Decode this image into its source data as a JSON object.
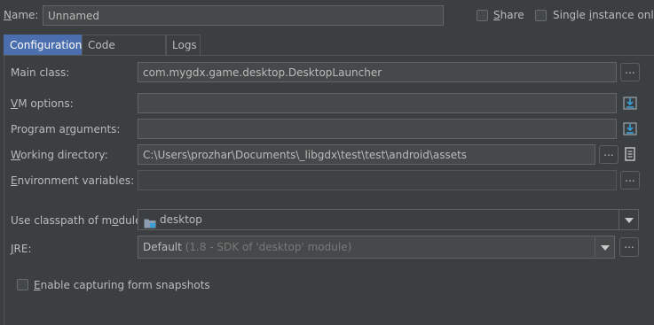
{
  "header": {
    "name_label": "Name:",
    "name_value": "Unnamed",
    "share_label": "Share",
    "single_instance_label": "Single instance only",
    "share_checked": false,
    "single_instance_checked": false
  },
  "tabs": [
    {
      "label": "Configuration",
      "active": true
    },
    {
      "label": "Code Coverage",
      "active": false
    },
    {
      "label": "Logs",
      "active": false
    }
  ],
  "form": {
    "main_class_label": "Main class:",
    "main_class_value": "com.mygdx.game.desktop.DesktopLauncher",
    "vm_options_label": "VM options:",
    "vm_options_value": "",
    "program_args_label": "Program arguments:",
    "program_args_value": "",
    "working_dir_label": "Working directory:",
    "working_dir_value": "C:\\Users\\prozhar\\Documents\\_libgdx\\test\\test\\android\\assets",
    "env_vars_label": "Environment variables:",
    "env_vars_value": "",
    "classpath_label": "Use classpath of module:",
    "classpath_value": "desktop",
    "jre_label": "JRE:",
    "jre_value": "Default",
    "jre_detail": "(1.8 - SDK of 'desktop' module)",
    "snapshots_label": "Enable capturing form snapshots",
    "snapshots_checked": false,
    "browse_label": "..."
  },
  "colors": {
    "background": "#3c3f41",
    "field": "#45494a",
    "tab_active": "#4b6eaf",
    "folder_icon": "#6a8fb8"
  }
}
